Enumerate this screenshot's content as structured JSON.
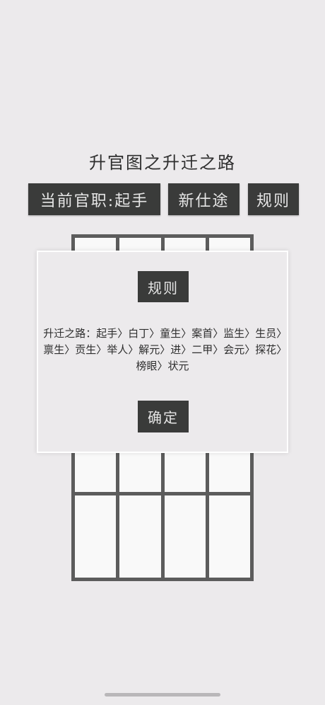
{
  "title": "升官图之升迁之路",
  "toolbar": {
    "rank_label": "当前官职:起手",
    "new_career_label": "新仕途",
    "rules_label": "规则"
  },
  "modal": {
    "title": "规则",
    "body": "升迁之路：起手〉白丁〉童生〉案首〉监生〉生员〉禀生〉贡生〉举人〉解元〉进〉二甲〉会元〉探花〉榜眼〉状元",
    "confirm_label": "确定"
  }
}
